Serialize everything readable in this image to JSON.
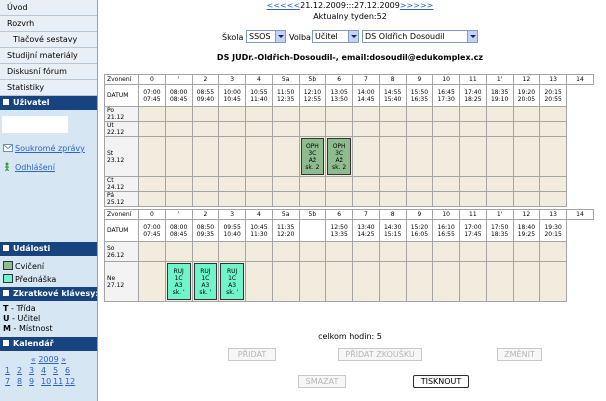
{
  "sidebar": {
    "menu": [
      "Úvod",
      "Rozvrh",
      "Tlačové sestavy",
      "Studijní materiály",
      "Diskusní fórum",
      "Statistiky"
    ],
    "user_section": "Uživatel",
    "user_links": [
      "Soukromé zprávy",
      "Odhlášení"
    ],
    "events_section": "Události",
    "legend": [
      "Cvičení",
      "Přednáška"
    ],
    "shortcuts_section": "Zkratkové klávesy:",
    "shortcuts": [
      {
        "key": "T",
        "label": "- Třída"
      },
      {
        "key": "U",
        "label": "- Učitel"
      },
      {
        "key": "M",
        "label": "- Místnost"
      }
    ],
    "calendar_section": "Kalendář",
    "calendar_year": "2009",
    "calendar_rows": [
      [
        "1",
        "2",
        "3",
        "4",
        "5",
        "6"
      ],
      [
        "7",
        "8",
        "9",
        "10",
        "11",
        "12"
      ]
    ],
    "colors": {
      "cviceni": "#8fbc8f",
      "prednaska": "#6ff5c9",
      "section": "#17447f"
    }
  },
  "week": {
    "prev": "<<<<<",
    "range": "21.12.2009:::27.12.2009",
    "next": ">>>>>",
    "current": "Aktualny tyden:52"
  },
  "filters": {
    "school_label": "Škola",
    "school_value": "SSOS",
    "mode_label": "Volba",
    "mode_value": "Učitel",
    "person_value": "DS Oldřich Dosoudil"
  },
  "teacher_headline": "DS  JUDr.-Oldřich-Dosoudil-,    email:dosoudil@edukomplex.cz",
  "schedule": {
    "block1": {
      "headers": [
        "Zvonení",
        "0",
        "'",
        "2",
        "3",
        "4",
        "5a",
        "5b",
        "6",
        "7",
        "8",
        "9",
        "10",
        "11",
        "1'",
        "12",
        "13",
        "14"
      ],
      "datum_label": "DATUM",
      "times": [
        "07:00 07:45",
        "08:00 08:45",
        "08:55 09:40",
        "10:00 10:45",
        "10:55 11:40",
        "11:50 12:35",
        "12:10 12:55",
        "13:05 13:50",
        "14:00 14:45",
        "14:55 15:40",
        "15:50 16:35",
        "16:45 17:30",
        "17:40 18:25",
        "18:35 19:10",
        "19:20 20:05",
        "20:15 20:55"
      ],
      "days": [
        {
          "name": "Po",
          "date": "21.12"
        },
        {
          "name": "Út",
          "date": "22.12"
        },
        {
          "name": "St",
          "date": "23.12",
          "events": [
            {
              "col": 7,
              "kind": "cv",
              "lines": [
                "OPH",
                "3C",
                "Až",
                "sk. 2"
              ]
            },
            {
              "col": 8,
              "kind": "cv",
              "lines": [
                "OPH",
                "3C",
                "Až",
                "sk. 2"
              ]
            }
          ]
        },
        {
          "name": "Čt",
          "date": "24.12"
        },
        {
          "name": "Pá",
          "date": "25.12"
        }
      ]
    },
    "block2": {
      "headers": [
        "Zvonení",
        "0",
        "'",
        "2",
        "3",
        "4",
        "5a",
        "5b",
        "6",
        "7",
        "8",
        "9",
        "10",
        "11",
        "1'",
        "12",
        "13",
        "14"
      ],
      "datum_label": "DATUM",
      "times": [
        "07:00 07:45",
        "08:00 08:45",
        "08:50 09:35",
        "09:55 10:40",
        "10:45 11:30",
        "11:35 12:20",
        "",
        "12:50 13:35",
        "13:40 14:25",
        "14:30 15:15",
        "15:20 16:05",
        "16:10 16:55",
        "17:00 17:45",
        "17:50 18:35",
        "18:40 19:25",
        "19:30 20:15"
      ],
      "days": [
        {
          "name": "So",
          "date": "26.12"
        },
        {
          "name": "Ne",
          "date": "27.12",
          "events": [
            {
              "col": 2,
              "kind": "pr",
              "lines": [
                "RUJ",
                "1C",
                "A3",
                "sk. '"
              ]
            },
            {
              "col": 3,
              "kind": "pr",
              "lines": [
                "RUJ",
                "1C",
                "A3",
                "sk. '"
              ]
            },
            {
              "col": 4,
              "kind": "pr",
              "lines": [
                "RUJ",
                "1C",
                "A3",
                "sk. '"
              ]
            }
          ]
        }
      ]
    }
  },
  "total_hours": "celkom hodin: 5",
  "buttons": {
    "add": "PŘIDAT",
    "add_exam": "PŘIDAT ZKOUŠKU",
    "change": "ZMĚNIT",
    "delete": "SMAZAT",
    "print": "TISKNOUT"
  }
}
